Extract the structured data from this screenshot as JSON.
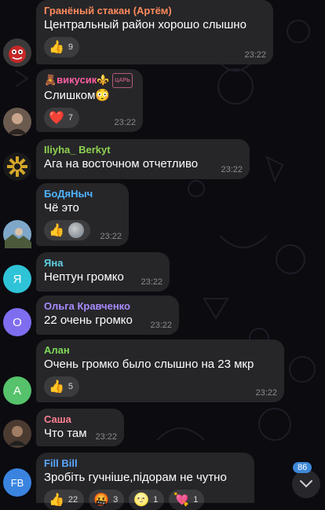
{
  "colors": {
    "background": "#0b0b10",
    "bubble": "#262629",
    "time": "#8a8a90",
    "badge_blue": "#3e88d8"
  },
  "messages": [
    {
      "sender": "Гранёный стакан (Артём)",
      "sender_color": "#ff8a5c",
      "text": "Центральный район хорошо слышно",
      "time": "23:22",
      "reaction": {
        "emoji": "👍",
        "count": "9"
      },
      "avatar": {
        "kind": "image",
        "icon": "red-creature-avatar-icon",
        "color": "#c62828"
      }
    },
    {
      "sender": "🧸викусик⚜️",
      "sender_badge": "ЦАРЬ",
      "sender_color": "#ff5fa2",
      "text": "Слишком😳",
      "time": "23:22",
      "reaction": {
        "emoji": "❤️",
        "count": "7"
      },
      "avatar": {
        "kind": "image",
        "icon": "person-photo-avatar-icon",
        "color": "#6b5b4f"
      }
    },
    {
      "sender": "Iliyha_ Berkyt",
      "sender_color": "#8fd14f",
      "text": "Ага на восточном отчетливо",
      "time": "23:22",
      "avatar": {
        "kind": "image",
        "icon": "gold-ornament-avatar-icon",
        "color": "#1a1a1a"
      }
    },
    {
      "sender": "БоДяНыч",
      "sender_color": "#4fb3ff",
      "text": "Чё это",
      "time": "23:22",
      "reaction": {
        "emoji": "👍",
        "count": ""
      },
      "avatar": {
        "kind": "image",
        "icon": "landscape-photo-avatar-icon",
        "color": "#7fa7c9"
      }
    },
    {
      "sender": "Яна",
      "sender_color": "#5ed1e0",
      "text": "Нептун громко",
      "time": "23:22",
      "avatar": {
        "kind": "initial",
        "letter": "Я",
        "color": "#2fc3d8"
      }
    },
    {
      "sender": "Ольга Кравченко",
      "sender_color": "#a88cff",
      "text": "22 очень громко",
      "time": "23:22",
      "avatar": {
        "kind": "initial",
        "letter": "О",
        "color": "#7f6df0"
      }
    },
    {
      "sender": "Алан",
      "sender_color": "#7ed957",
      "text": "Очень громко было слышно на 23 мкр",
      "time": "23:22",
      "reaction": {
        "emoji": "👍",
        "count": "5"
      },
      "avatar": {
        "kind": "initial",
        "letter": "А",
        "color": "#56c26b"
      }
    },
    {
      "sender": "Саша",
      "sender_color": "#ff7f8f",
      "text": "Что там",
      "time": "23:22",
      "avatar": {
        "kind": "image",
        "icon": "dark-photo-avatar-icon",
        "color": "#4a3a30"
      }
    },
    {
      "sender": "Fill Bill",
      "sender_color": "#5aa7ff",
      "text": "Зробіть гучніше,підорам не чутно",
      "avatar": {
        "kind": "initial",
        "letter": "FB",
        "color": "#3a84e0"
      },
      "reactions": [
        {
          "emoji": "👍",
          "count": "22"
        },
        {
          "emoji": "🤬",
          "count": "3"
        },
        {
          "emoji": "🌝",
          "count": "1"
        },
        {
          "emoji": "💘",
          "count": "1"
        }
      ]
    }
  ],
  "scroll_down": {
    "unread_count": "86",
    "icon": "chevron-down-icon"
  }
}
